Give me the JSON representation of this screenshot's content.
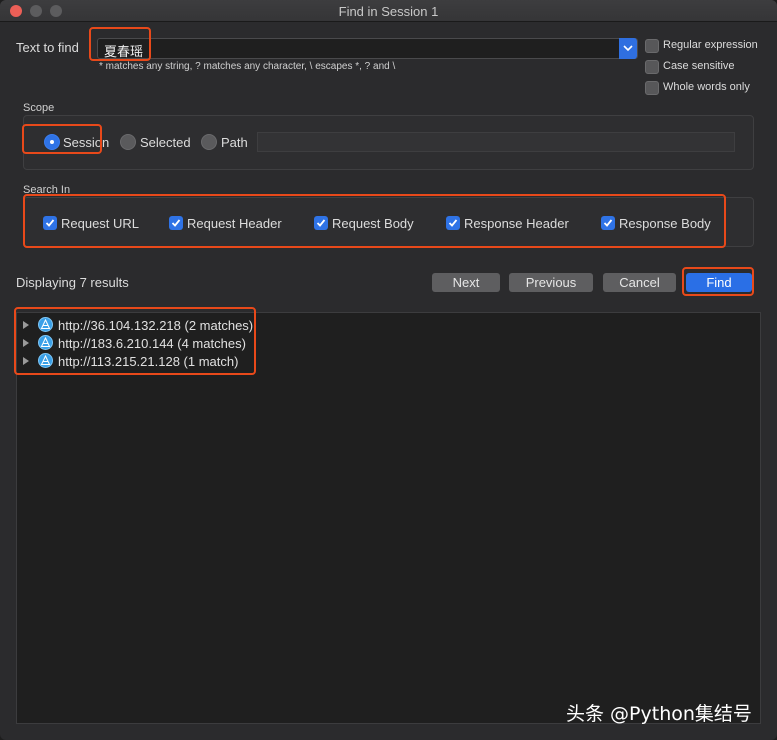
{
  "window": {
    "title": "Find in Session 1"
  },
  "find": {
    "label": "Text to find",
    "value": "夏春瑶",
    "hint": "* matches any string, ? matches any character, \\ escapes *, ? and \\"
  },
  "options": [
    {
      "label": "Regular expression",
      "checked": false
    },
    {
      "label": "Case sensitive",
      "checked": false
    },
    {
      "label": "Whole words only",
      "checked": false
    }
  ],
  "scope": {
    "label": "Scope",
    "items": [
      {
        "label": "Session",
        "selected": true
      },
      {
        "label": "Selected",
        "selected": false
      },
      {
        "label": "Path",
        "selected": false
      }
    ],
    "path_value": ""
  },
  "search_in": {
    "label": "Search In",
    "items": [
      {
        "label": "Request URL",
        "checked": true
      },
      {
        "label": "Request Header",
        "checked": true
      },
      {
        "label": "Request Body",
        "checked": true
      },
      {
        "label": "Response Header",
        "checked": true
      },
      {
        "label": "Response Body",
        "checked": true
      }
    ]
  },
  "status": {
    "text": "Displaying 7 results"
  },
  "buttons": {
    "next": "Next",
    "previous": "Previous",
    "cancel": "Cancel",
    "find": "Find"
  },
  "results": [
    {
      "text": "http://36.104.132.218 (2 matches)"
    },
    {
      "text": "http://183.6.210.144 (4 matches)"
    },
    {
      "text": "http://113.215.21.128 (1 match)"
    }
  ],
  "watermark": "头条 @Python集结号",
  "colors": {
    "accent": "#2f73e6",
    "highlight": "#e8491a",
    "background": "#2b2b2d"
  }
}
